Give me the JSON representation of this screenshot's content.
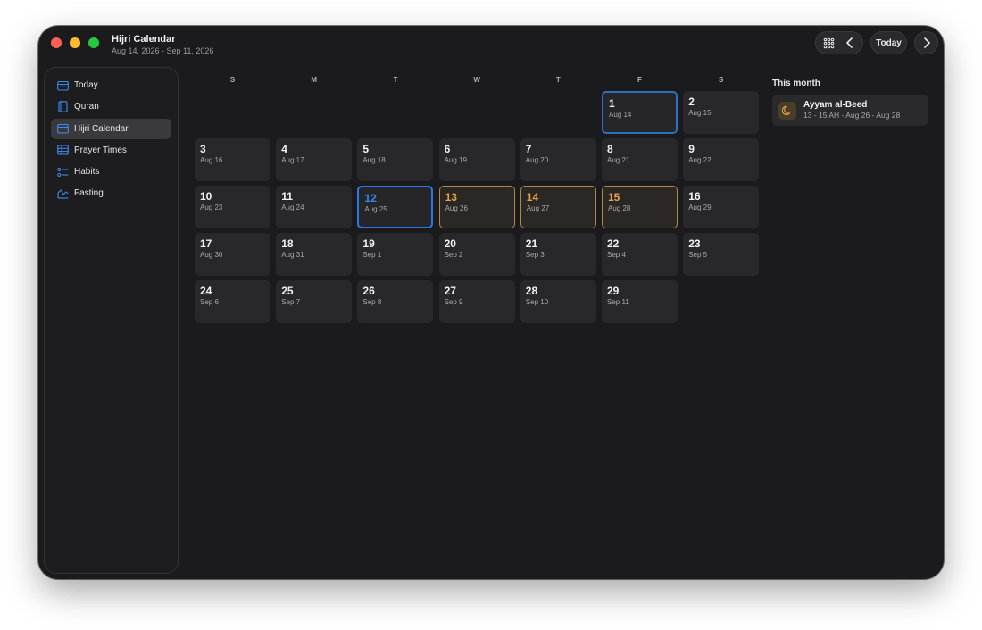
{
  "window": {
    "title": "Hijri Calendar",
    "subtitle": "Aug 14, 2026 - Sep 11, 2026"
  },
  "toolbar": {
    "today_label": "Today",
    "icons": [
      "grid-icon",
      "chevron-left-icon",
      "chevron-right-icon"
    ]
  },
  "sidebar": {
    "items": [
      {
        "label": "Today",
        "icon": "calendar-today-icon",
        "active": false
      },
      {
        "label": "Quran",
        "icon": "book-icon",
        "active": false
      },
      {
        "label": "Hijri Calendar",
        "icon": "calendar-icon",
        "active": true
      },
      {
        "label": "Prayer Times",
        "icon": "table-icon",
        "active": false
      },
      {
        "label": "Habits",
        "icon": "checklist-icon",
        "active": false
      },
      {
        "label": "Fasting",
        "icon": "chart-icon",
        "active": false
      }
    ]
  },
  "calendar": {
    "weekdays": [
      "S",
      "M",
      "T",
      "W",
      "T",
      "F",
      "S"
    ],
    "first_weekday_index": 5,
    "today_day": 1,
    "selected_day": 12,
    "white_days": [
      13,
      14,
      15
    ],
    "days": [
      {
        "h": "1",
        "g": "Aug 14"
      },
      {
        "h": "2",
        "g": "Aug 15"
      },
      {
        "h": "3",
        "g": "Aug 16"
      },
      {
        "h": "4",
        "g": "Aug 17"
      },
      {
        "h": "5",
        "g": "Aug 18"
      },
      {
        "h": "6",
        "g": "Aug 19"
      },
      {
        "h": "7",
        "g": "Aug 20"
      },
      {
        "h": "8",
        "g": "Aug 21"
      },
      {
        "h": "9",
        "g": "Aug 22"
      },
      {
        "h": "10",
        "g": "Aug 23"
      },
      {
        "h": "11",
        "g": "Aug 24"
      },
      {
        "h": "12",
        "g": "Aug 25"
      },
      {
        "h": "13",
        "g": "Aug 26"
      },
      {
        "h": "14",
        "g": "Aug 27"
      },
      {
        "h": "15",
        "g": "Aug 28"
      },
      {
        "h": "16",
        "g": "Aug 29"
      },
      {
        "h": "17",
        "g": "Aug 30"
      },
      {
        "h": "18",
        "g": "Aug 31"
      },
      {
        "h": "19",
        "g": "Sep 1"
      },
      {
        "h": "20",
        "g": "Sep 2"
      },
      {
        "h": "21",
        "g": "Sep 3"
      },
      {
        "h": "22",
        "g": "Sep 4"
      },
      {
        "h": "23",
        "g": "Sep 5"
      },
      {
        "h": "24",
        "g": "Sep 6"
      },
      {
        "h": "25",
        "g": "Sep 7"
      },
      {
        "h": "26",
        "g": "Sep 8"
      },
      {
        "h": "27",
        "g": "Sep 9"
      },
      {
        "h": "28",
        "g": "Sep 10"
      },
      {
        "h": "29",
        "g": "Sep 11"
      }
    ]
  },
  "panel": {
    "heading": "This month",
    "events": [
      {
        "title": "Ayyam al-Beed",
        "subtitle": "13 - 15 AH - Aug 26 - Aug 28",
        "icon": "moon-icon"
      }
    ]
  },
  "colors": {
    "accent_blue": "#2b78e4",
    "white_days_amber": "#e2a64e"
  }
}
